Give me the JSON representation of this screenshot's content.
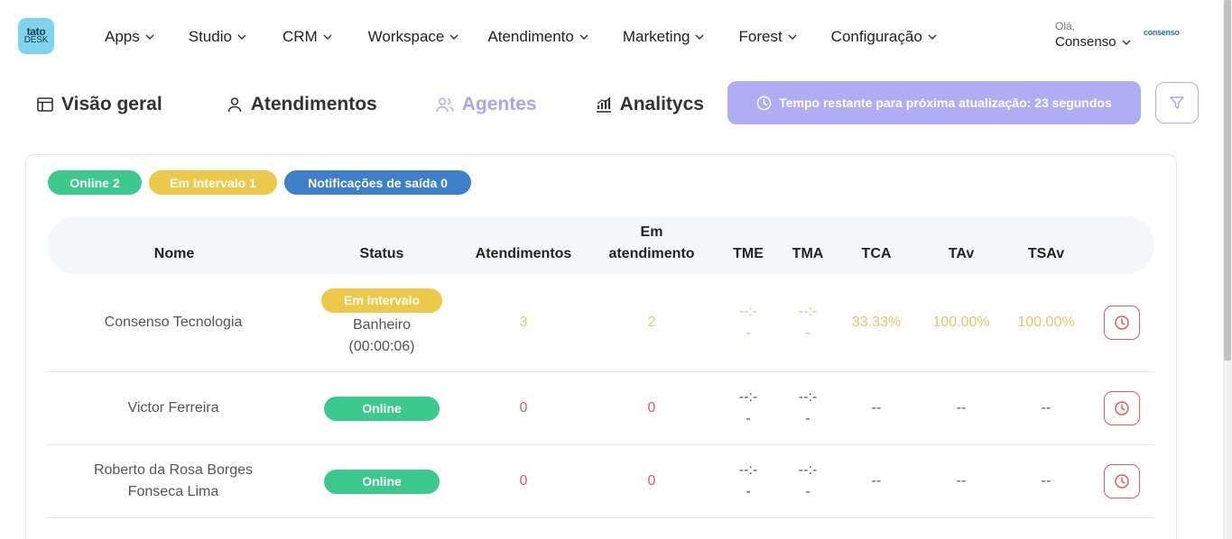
{
  "logo": {
    "line1": "tato",
    "line2": "DESK"
  },
  "nav": {
    "items": [
      {
        "label": "Apps"
      },
      {
        "label": "Studio"
      },
      {
        "label": "CRM"
      },
      {
        "label": "Workspace"
      },
      {
        "label": "Atendimento"
      },
      {
        "label": "Marketing"
      },
      {
        "label": "Forest"
      },
      {
        "label": "Configuração"
      }
    ]
  },
  "user": {
    "greeting": "Olá,",
    "name": "Consenso",
    "brand": "consenso"
  },
  "tabs": [
    {
      "label": "Visão geral",
      "icon": "layout-icon",
      "active": false
    },
    {
      "label": "Atendimentos",
      "icon": "user-icon",
      "active": false
    },
    {
      "label": "Agentes",
      "icon": "users-icon",
      "active": true
    },
    {
      "label": "Analitycs",
      "icon": "bar-chart-icon",
      "active": false
    }
  ],
  "timer": {
    "label": "Tempo restante para próxima atualização: 23 segundos"
  },
  "colors": {
    "accent": "#b1adf4",
    "online": "#3cc98d",
    "interval": "#ecc94b",
    "notify": "#3d7fc8",
    "red": "#e55a5a",
    "amber": "#e6c36a"
  },
  "badges": [
    {
      "label": "Online 2",
      "color": "#3cc98d"
    },
    {
      "label": "Em intervalo 1",
      "color": "#ecc94b"
    },
    {
      "label": "Notificações de saída 0",
      "color": "#3d7fc8"
    }
  ],
  "table": {
    "columns": [
      "Nome",
      "Status",
      "Atendimentos",
      "Em\natendimento",
      "TME",
      "TMA",
      "TCA",
      "TAv",
      "TSAv"
    ],
    "rows": [
      {
        "name": "Consenso Tecnologia",
        "status": "Em intervalo",
        "status_type": "interval",
        "status_note": "Banheiro\n(00:00:06)",
        "atendimentos": "3",
        "em_atendimento": "2",
        "tme": "--:-\n-",
        "tma": "--:-\n-",
        "tca": "33.33%",
        "tav": "100.00%",
        "tsav": "100.00%",
        "value_tone": "amber"
      },
      {
        "name": "Victor Ferreira",
        "status": "Online",
        "status_type": "online",
        "status_note": "",
        "atendimentos": "0",
        "em_atendimento": "0",
        "tme": "--:-\n-",
        "tma": "--:-\n-",
        "tca": "--",
        "tav": "--",
        "tsav": "--",
        "value_tone": "red"
      },
      {
        "name": "Roberto da Rosa Borges\nFonseca Lima",
        "status": "Online",
        "status_type": "online",
        "status_note": "",
        "atendimentos": "0",
        "em_atendimento": "0",
        "tme": "--:-\n-",
        "tma": "--:-\n-",
        "tca": "--",
        "tav": "--",
        "tsav": "--",
        "value_tone": "red"
      }
    ]
  }
}
